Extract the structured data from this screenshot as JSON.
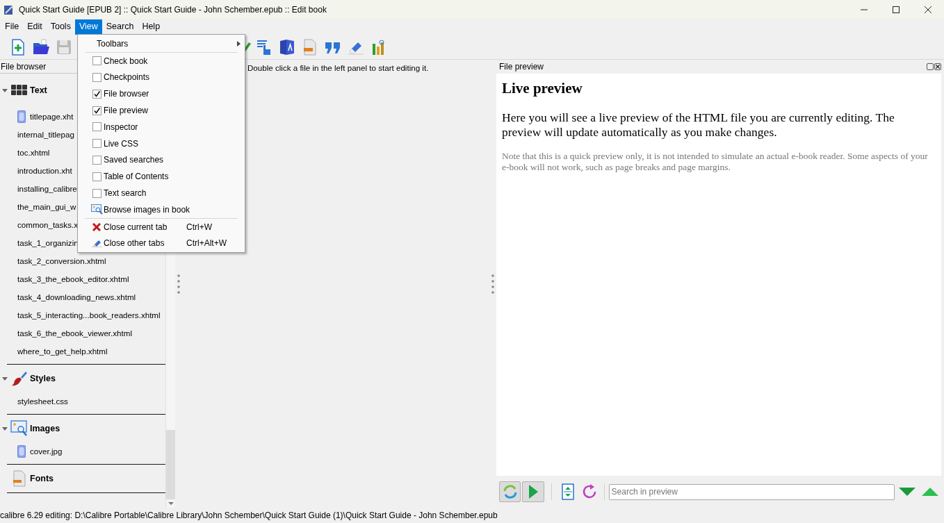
{
  "window": {
    "title": "Quick Start Guide [EPUB 2] :: Quick Start Guide - John Schember.epub :: Edit book"
  },
  "menubar": [
    {
      "label": "File",
      "selected": false
    },
    {
      "label": "Edit",
      "selected": false
    },
    {
      "label": "Tools",
      "selected": false
    },
    {
      "label": "View",
      "selected": true
    },
    {
      "label": "Search",
      "selected": false
    },
    {
      "label": "Help",
      "selected": false
    }
  ],
  "view_menu": {
    "groups": [
      [
        {
          "kind": "submenu",
          "label": "Toolbars"
        }
      ],
      [
        {
          "kind": "check",
          "label": "Check book",
          "checked": false
        },
        {
          "kind": "check",
          "label": "Checkpoints",
          "checked": false
        },
        {
          "kind": "check",
          "label": "File browser",
          "checked": true
        },
        {
          "kind": "check",
          "label": "File preview",
          "checked": true
        },
        {
          "kind": "check",
          "label": "Inspector",
          "checked": false
        },
        {
          "kind": "check",
          "label": "Live CSS",
          "checked": false
        },
        {
          "kind": "check",
          "label": "Saved searches",
          "checked": false
        },
        {
          "kind": "check",
          "label": "Table of Contents",
          "checked": false
        },
        {
          "kind": "check",
          "label": "Text search",
          "checked": false
        },
        {
          "kind": "browse",
          "label": "Browse images in book"
        }
      ],
      [
        {
          "kind": "close",
          "label": "Close current tab",
          "shortcut": "Ctrl+W"
        },
        {
          "kind": "closeothers",
          "label": "Close other tabs",
          "shortcut": "Ctrl+Alt+W"
        }
      ]
    ]
  },
  "file_browser": {
    "title": "File browser",
    "categories": [
      {
        "kind": "text",
        "label": "Text",
        "expanded": true,
        "children": [
          {
            "kind": "cover",
            "name": "titlepage.xht"
          },
          {
            "kind": "file",
            "name": "internal_titlepag"
          },
          {
            "kind": "file",
            "name": "toc.xhtml"
          },
          {
            "kind": "file",
            "name": "introduction.xht"
          },
          {
            "kind": "file",
            "name": "installing_calibre"
          },
          {
            "kind": "file",
            "name": "the_main_gui_w"
          },
          {
            "kind": "file",
            "name": "common_tasks.x"
          },
          {
            "kind": "file",
            "name": "task_1_organizin"
          },
          {
            "kind": "file",
            "name": "task_2_conversion.xhtml"
          },
          {
            "kind": "file",
            "name": "task_3_the_ebook_editor.xhtml"
          },
          {
            "kind": "file",
            "name": "task_4_downloading_news.xhtml"
          },
          {
            "kind": "file",
            "name": "task_5_interacting...book_readers.xhtml"
          },
          {
            "kind": "file",
            "name": "task_6_the_ebook_viewer.xhtml"
          },
          {
            "kind": "file",
            "name": "where_to_get_help.xhtml"
          }
        ]
      },
      {
        "kind": "styles",
        "label": "Styles",
        "expanded": true,
        "children": [
          {
            "kind": "file",
            "name": "stylesheet.css"
          }
        ]
      },
      {
        "kind": "images",
        "label": "Images",
        "expanded": true,
        "children": [
          {
            "kind": "cover",
            "name": "cover.jpg"
          }
        ]
      },
      {
        "kind": "fonts",
        "label": "Fonts",
        "expanded": false
      }
    ]
  },
  "editor": {
    "message": "Double click a file in the left panel to start editing it."
  },
  "preview": {
    "title": "File preview",
    "heading": "Live preview",
    "paragraph": "Here you will see a live preview of the HTML file you are currently editing. The preview will update automatically as you make changes.",
    "note": "Note that this is a quick preview only, it is not intended to simulate an actual e-book reader. Some aspects of your e-book will not work, such as page breaks and page margins.",
    "search_placeholder": "Search in preview"
  },
  "status_bar": "calibre 6.29 editing: D:\\Calibre Portable\\Calibre Library\\John Schember\\Quick Start Guide (1)\\Quick Start Guide - John Schember.epub"
}
